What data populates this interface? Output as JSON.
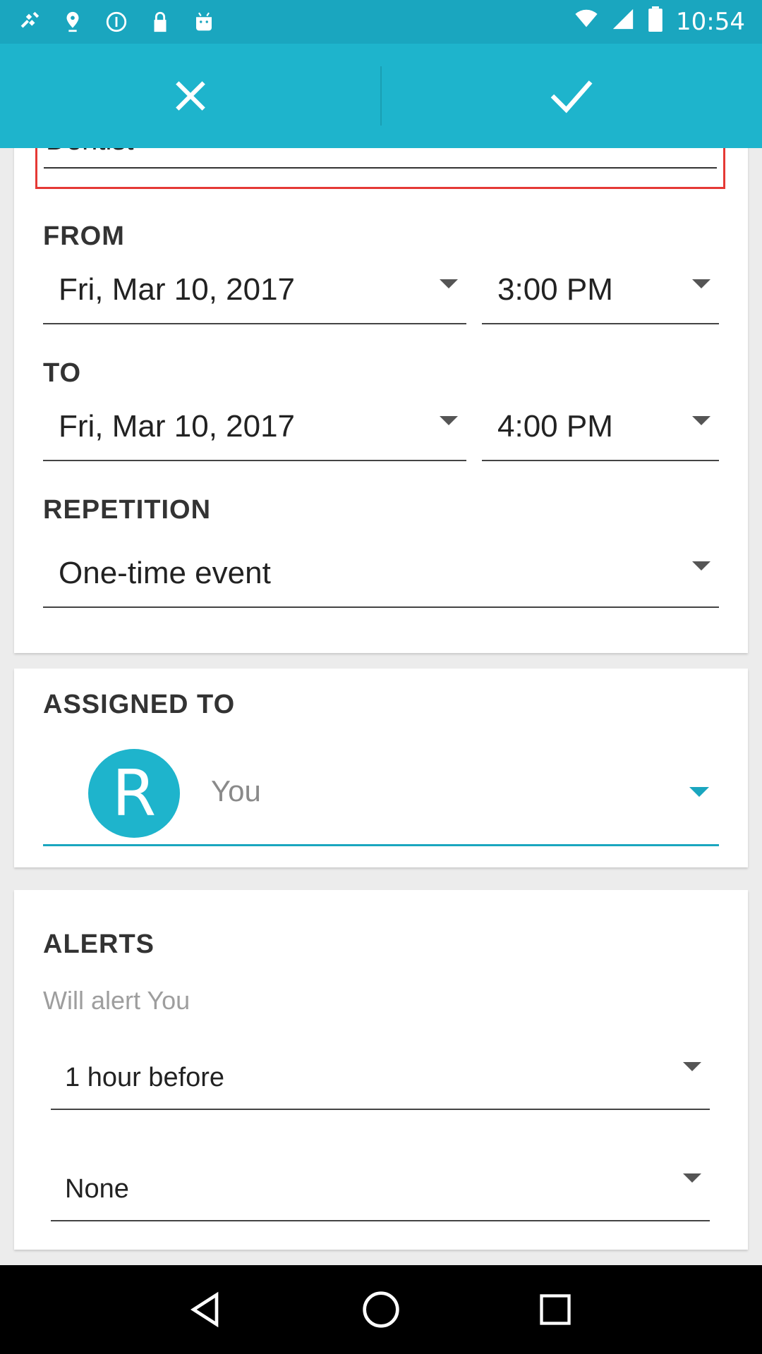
{
  "status_bar": {
    "time": "10:54",
    "icons": [
      "fake-gps-icon",
      "location-icon",
      "sync-icon",
      "lock-icon",
      "android-icon",
      "wifi-icon",
      "signal-icon",
      "battery-icon"
    ]
  },
  "action_bar": {
    "cancel_icon": "close-icon",
    "confirm_icon": "check-icon"
  },
  "event": {
    "title": "Dentist",
    "from_label": "FROM",
    "from_date": "Fri, Mar 10, 2017",
    "from_time": "3:00 PM",
    "to_label": "TO",
    "to_date": "Fri, Mar 10, 2017",
    "to_time": "4:00 PM",
    "repetition_label": "REPETITION",
    "repetition_value": "One-time event"
  },
  "assigned": {
    "label": "ASSIGNED TO",
    "avatar_initial": "R",
    "name": "You"
  },
  "alerts": {
    "label": "ALERTS",
    "subtitle": "Will alert You",
    "alert1": "1 hour before",
    "alert2": "None"
  },
  "colors": {
    "primary": "#1eb4cc",
    "primary_dark": "#1aa6bf",
    "highlight": "#e53935"
  }
}
